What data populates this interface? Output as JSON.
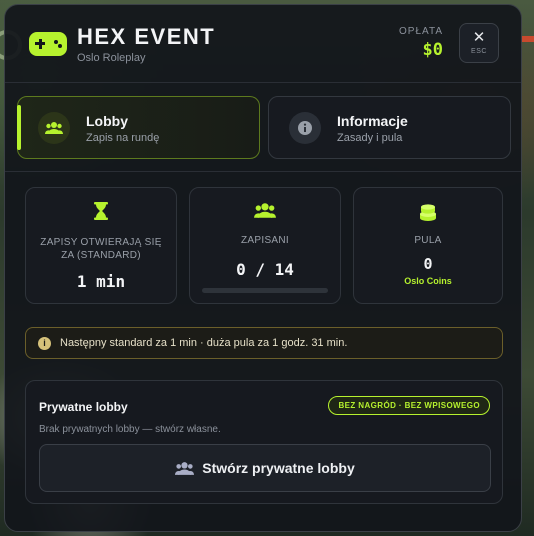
{
  "header": {
    "title": "HEX EVENT",
    "subtitle": "Oslo Roleplay",
    "fee_label": "OPŁATA",
    "fee_value": "$0",
    "close_label": "ESC"
  },
  "tabs": [
    {
      "title": "Lobby",
      "subtitle": "Zapis na rundę",
      "icon": "users-icon",
      "active": true
    },
    {
      "title": "Informacje",
      "subtitle": "Zasady i pula",
      "icon": "info-icon",
      "active": false
    }
  ],
  "stats": {
    "registration": {
      "label": "ZAPISY OTWIERAJĄ SIĘ ZA (STANDARD)",
      "value": "1 min",
      "icon": "hourglass-icon"
    },
    "signed_up": {
      "label": "ZAPISANI",
      "value": "0 / 14",
      "progress": 0,
      "icon": "users-icon"
    },
    "pool": {
      "label": "PULA",
      "value": "0",
      "unit": "Oslo Coins",
      "icon": "coins-icon"
    }
  },
  "notice": {
    "icon": "info-icon",
    "text": "Następny standard za 1 min · duża pula za 1 godz. 31 min."
  },
  "private_lobby": {
    "title": "Prywatne lobby",
    "badge": "BEZ NAGRÓD · BEZ WPISOWEGO",
    "description": "Brak prywatnych lobby — stwórz własne.",
    "create_label": "Stwórz prywatne lobby"
  },
  "colors": {
    "accent": "#b6f22e",
    "panel": "#12151b",
    "warning_border": "#6b5f2a"
  }
}
